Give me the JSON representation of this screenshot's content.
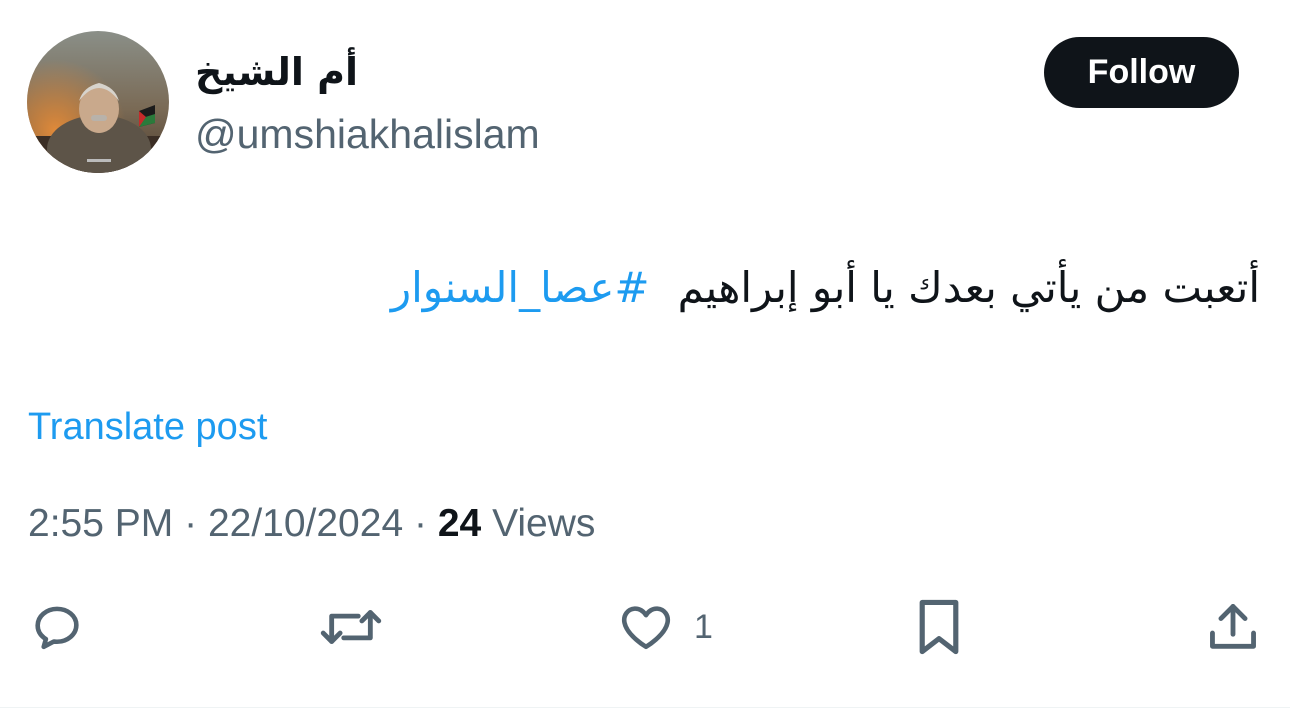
{
  "author": {
    "display_name": "أم الشيخ",
    "handle": "@umshiakhalislam",
    "avatar": "avatar-photo"
  },
  "follow_label": "Follow",
  "post": {
    "text": "أتعبت من يأتي بعدك يا أبو إبراهيم",
    "hashtag": "#عصا_السنوار"
  },
  "translate_label": "Translate post",
  "meta": {
    "time": "2:55 PM",
    "date": "22/10/2024",
    "separator": "·",
    "views_count": "24",
    "views_label": "Views"
  },
  "actions": {
    "reply_icon": "reply-icon",
    "repost_icon": "repost-icon",
    "like_icon": "heart-icon",
    "like_count": "1",
    "bookmark_icon": "bookmark-icon",
    "share_icon": "share-icon"
  },
  "colors": {
    "text_primary": "#0f1419",
    "text_secondary": "#536471",
    "accent": "#1d9bf0",
    "button_bg": "#0f1419"
  }
}
